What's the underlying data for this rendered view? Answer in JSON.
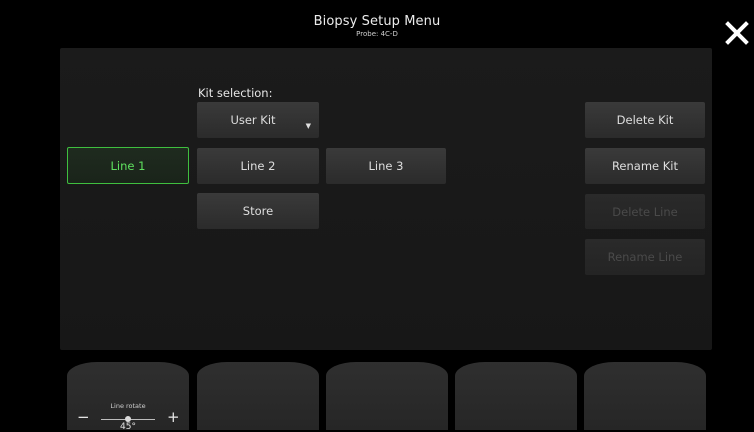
{
  "header": {
    "title": "Biopsy Setup Menu",
    "subtitle": "Probe: 4C-D"
  },
  "kit": {
    "label": "Kit selection:",
    "selected": "User Kit"
  },
  "lines": {
    "line1": "Line 1",
    "line2": "Line 2",
    "line3": "Line 3",
    "active": "Line 1"
  },
  "buttons": {
    "store": "Store",
    "delete_kit": "Delete Kit",
    "rename_kit": "Rename Kit",
    "delete_line": "Delete Line",
    "rename_line": "Rename Line"
  },
  "softkeys": {
    "line_rotate": {
      "label": "Line rotate",
      "minus": "−",
      "plus": "+",
      "value": "45°"
    }
  },
  "icons": {
    "close": "close-icon",
    "dropdown": "chevron-down-icon"
  },
  "colors": {
    "active_accent": "#3fbf3f",
    "active_text": "#5fe05f",
    "button_bg": "#333333",
    "disabled_text": "#4a4a4a"
  }
}
